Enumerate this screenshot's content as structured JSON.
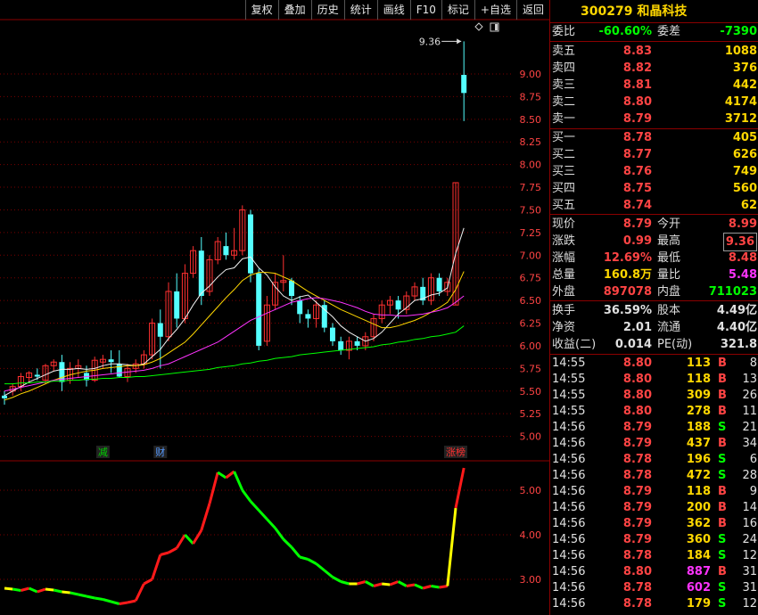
{
  "toolbar": {
    "buttons": [
      "复权",
      "叠加",
      "历史",
      "统计",
      "画线",
      "F10",
      "标记",
      "+自选",
      "返回"
    ]
  },
  "kline": {
    "price_labels": [
      "9.00",
      "8.75",
      "8.50",
      "8.25",
      "8.00",
      "7.75",
      "7.50",
      "7.25",
      "7.00",
      "6.75",
      "6.50",
      "6.25",
      "6.00",
      "5.75",
      "5.50",
      "5.25",
      "5.00"
    ],
    "high_marker": "9.36",
    "event_tags": [
      "减",
      "财",
      "涨榜"
    ]
  },
  "indicator": {
    "labels": [
      "5.00",
      "4.00",
      "3.00"
    ]
  },
  "chart_data": [
    {
      "type": "candlestick",
      "ylim": [
        4.75,
        9.6
      ],
      "candles": [
        [
          5.45,
          5.5,
          5.35,
          5.42
        ],
        [
          5.5,
          5.58,
          5.45,
          5.55
        ],
        [
          5.55,
          5.7,
          5.5,
          5.66
        ],
        [
          5.65,
          5.72,
          5.6,
          5.7
        ],
        [
          5.68,
          5.75,
          5.62,
          5.66
        ],
        [
          5.62,
          5.8,
          5.58,
          5.78
        ],
        [
          5.78,
          5.85,
          5.72,
          5.82
        ],
        [
          5.82,
          5.9,
          5.5,
          5.6
        ],
        [
          5.62,
          5.82,
          5.58,
          5.75
        ],
        [
          5.75,
          5.85,
          5.65,
          5.78
        ],
        [
          5.7,
          5.78,
          5.55,
          5.62
        ],
        [
          5.62,
          5.88,
          5.6,
          5.84
        ],
        [
          5.82,
          5.9,
          5.75,
          5.85
        ],
        [
          5.85,
          5.95,
          5.7,
          5.82
        ],
        [
          5.8,
          5.95,
          5.65,
          5.66
        ],
        [
          5.66,
          5.8,
          5.6,
          5.75
        ],
        [
          5.75,
          5.85,
          5.7,
          5.8
        ],
        [
          5.8,
          5.95,
          5.75,
          5.9
        ],
        [
          5.9,
          6.3,
          5.85,
          6.25
        ],
        [
          6.25,
          6.4,
          5.75,
          6.1
        ],
        [
          6.1,
          6.7,
          6.05,
          6.6
        ],
        [
          6.6,
          6.8,
          6.2,
          6.3
        ],
        [
          6.3,
          6.9,
          6.25,
          6.8
        ],
        [
          6.8,
          7.1,
          6.75,
          7.05
        ],
        [
          7.05,
          7.2,
          6.45,
          6.55
        ],
        [
          6.6,
          7.0,
          6.55,
          6.95
        ],
        [
          6.95,
          7.2,
          6.9,
          7.15
        ],
        [
          7.1,
          7.25,
          6.95,
          7.0
        ],
        [
          7.0,
          7.3,
          6.95,
          7.05
        ],
        [
          7.05,
          7.55,
          7.0,
          7.5
        ],
        [
          7.45,
          7.5,
          6.7,
          6.8
        ],
        [
          6.8,
          6.85,
          5.95,
          6.0
        ],
        [
          6.05,
          6.55,
          6.0,
          6.45
        ],
        [
          6.45,
          6.8,
          6.4,
          6.7
        ],
        [
          6.7,
          7.0,
          6.6,
          6.72
        ],
        [
          6.72,
          6.75,
          6.45,
          6.55
        ],
        [
          6.5,
          6.55,
          6.25,
          6.35
        ],
        [
          6.35,
          6.4,
          6.2,
          6.3
        ],
        [
          6.3,
          6.5,
          6.2,
          6.45
        ],
        [
          6.45,
          6.5,
          6.15,
          6.2
        ],
        [
          6.2,
          6.25,
          6.0,
          6.05
        ],
        [
          6.05,
          6.1,
          5.9,
          5.95
        ],
        [
          5.95,
          6.1,
          5.85,
          6.05
        ],
        [
          6.05,
          6.1,
          5.95,
          6.0
        ],
        [
          6.0,
          6.15,
          5.95,
          6.1
        ],
        [
          6.1,
          6.35,
          6.05,
          6.3
        ],
        [
          6.3,
          6.5,
          6.25,
          6.45
        ],
        [
          6.45,
          6.55,
          6.35,
          6.5
        ],
        [
          6.5,
          6.55,
          6.3,
          6.4
        ],
        [
          6.4,
          6.6,
          6.35,
          6.55
        ],
        [
          6.55,
          6.7,
          6.5,
          6.65
        ],
        [
          6.65,
          6.75,
          6.45,
          6.5
        ],
        [
          6.5,
          6.8,
          6.45,
          6.75
        ],
        [
          6.75,
          6.8,
          6.55,
          6.6
        ],
        [
          6.6,
          6.75,
          6.55,
          6.7
        ],
        [
          6.45,
          7.8,
          6.45,
          7.8
        ],
        [
          8.99,
          9.36,
          8.48,
          8.79
        ]
      ],
      "ma": {
        "ma5_white": [
          5.45,
          5.5,
          5.55,
          5.6,
          5.64,
          5.68,
          5.72,
          5.74,
          5.74,
          5.75,
          5.74,
          5.75,
          5.78,
          5.8,
          5.8,
          5.79,
          5.78,
          5.8,
          5.88,
          5.96,
          6.08,
          6.18,
          6.3,
          6.45,
          6.58,
          6.66,
          6.76,
          6.84,
          6.86,
          6.96,
          6.98,
          6.86,
          6.78,
          6.65,
          6.55,
          6.5,
          6.54,
          6.56,
          6.48,
          6.4,
          6.32,
          6.22,
          6.15,
          6.1,
          6.05,
          6.08,
          6.15,
          6.25,
          6.35,
          6.42,
          6.5,
          6.52,
          6.56,
          6.58,
          6.64,
          7.02,
          7.3
        ],
        "ma10_yellow": [
          5.4,
          5.43,
          5.47,
          5.5,
          5.54,
          5.58,
          5.62,
          5.65,
          5.68,
          5.7,
          5.72,
          5.73,
          5.75,
          5.76,
          5.77,
          5.78,
          5.78,
          5.79,
          5.82,
          5.86,
          5.92,
          5.98,
          6.04,
          6.13,
          6.23,
          6.33,
          6.43,
          6.53,
          6.62,
          6.72,
          6.78,
          6.81,
          6.81,
          6.8,
          6.76,
          6.72,
          6.66,
          6.6,
          6.55,
          6.5,
          6.45,
          6.4,
          6.36,
          6.32,
          6.28,
          6.24,
          6.2,
          6.2,
          6.22,
          6.25,
          6.28,
          6.32,
          6.37,
          6.42,
          6.48,
          6.62,
          6.82
        ],
        "ma20_magenta": [
          5.5,
          5.52,
          5.54,
          5.56,
          5.58,
          5.6,
          5.62,
          5.63,
          5.64,
          5.65,
          5.66,
          5.67,
          5.68,
          5.69,
          5.7,
          5.71,
          5.72,
          5.73,
          5.75,
          5.78,
          5.8,
          5.84,
          5.88,
          5.92,
          5.96,
          6.0,
          6.04,
          6.1,
          6.16,
          6.22,
          6.28,
          6.32,
          6.36,
          6.4,
          6.44,
          6.48,
          6.5,
          6.52,
          6.53,
          6.52,
          6.5,
          6.48,
          6.45,
          6.42,
          6.38,
          6.35,
          6.34,
          6.34,
          6.33,
          6.33,
          6.34,
          6.35,
          6.37,
          6.39,
          6.42,
          6.48,
          6.55
        ],
        "ma60_green": [
          5.58,
          5.58,
          5.59,
          5.59,
          5.6,
          5.6,
          5.61,
          5.61,
          5.62,
          5.62,
          5.63,
          5.63,
          5.64,
          5.64,
          5.65,
          5.65,
          5.66,
          5.66,
          5.67,
          5.68,
          5.69,
          5.7,
          5.71,
          5.72,
          5.73,
          5.74,
          5.76,
          5.77,
          5.78,
          5.8,
          5.81,
          5.83,
          5.84,
          5.86,
          5.87,
          5.88,
          5.9,
          5.91,
          5.92,
          5.93,
          5.94,
          5.95,
          5.96,
          5.97,
          5.98,
          5.99,
          6.01,
          6.02,
          6.04,
          6.05,
          6.07,
          6.08,
          6.1,
          6.11,
          6.13,
          6.15,
          6.22
        ]
      }
    },
    {
      "type": "line",
      "ylim": [
        2.2,
        5.6
      ],
      "values": [
        2.8,
        2.78,
        2.75,
        2.8,
        2.72,
        2.78,
        2.76,
        2.72,
        2.7,
        2.66,
        2.62,
        2.58,
        2.55,
        2.5,
        2.45,
        2.48,
        2.52,
        2.9,
        3.0,
        3.55,
        3.6,
        3.7,
        4.0,
        3.8,
        4.1,
        4.7,
        5.4,
        5.28,
        5.42,
        5.0,
        4.75,
        4.55,
        4.35,
        4.15,
        3.9,
        3.72,
        3.5,
        3.45,
        3.35,
        3.2,
        3.05,
        2.95,
        2.9,
        2.9,
        2.95,
        2.85,
        2.9,
        2.88,
        2.95,
        2.85,
        2.88,
        2.8,
        2.85,
        2.82,
        2.85,
        4.6,
        5.5
      ]
    }
  ],
  "quote": {
    "title": "300279 和晶科技",
    "weibi_label": "委比",
    "weibi": "-60.60%",
    "weicha_label": "委差",
    "weicha": "-7390",
    "asks": [
      {
        "label": "卖五",
        "price": "8.83",
        "vol": "1088"
      },
      {
        "label": "卖四",
        "price": "8.82",
        "vol": "376"
      },
      {
        "label": "卖三",
        "price": "8.81",
        "vol": "442"
      },
      {
        "label": "卖二",
        "price": "8.80",
        "vol": "4174"
      },
      {
        "label": "卖一",
        "price": "8.79",
        "vol": "3712"
      }
    ],
    "bids": [
      {
        "label": "买一",
        "price": "8.78",
        "vol": "405"
      },
      {
        "label": "买二",
        "price": "8.77",
        "vol": "626"
      },
      {
        "label": "买三",
        "price": "8.76",
        "vol": "749"
      },
      {
        "label": "买四",
        "price": "8.75",
        "vol": "560"
      },
      {
        "label": "买五",
        "price": "8.74",
        "vol": "62"
      }
    ],
    "stats": [
      {
        "l1": "现价",
        "v1": "8.79",
        "l2": "今开",
        "v2": "8.99"
      },
      {
        "l1": "涨跌",
        "v1": "0.99",
        "l2": "最高",
        "v2": "9.36"
      },
      {
        "l1": "涨幅",
        "v1": "12.69%",
        "l2": "最低",
        "v2": "8.48"
      },
      {
        "l1": "总量",
        "v1": "160.8万",
        "l2": "量比",
        "v2": "5.48"
      },
      {
        "l1": "外盘",
        "v1": "897078",
        "l2": "内盘",
        "v2": "711023"
      }
    ],
    "stats2": [
      {
        "l1": "换手",
        "v1": "36.59%",
        "l2": "股本",
        "v2": "4.49亿"
      },
      {
        "l1": "净资",
        "v1": "2.01",
        "l2": "流通",
        "v2": "4.40亿"
      },
      {
        "l1": "收益(二)",
        "v1": "0.014",
        "l2": "PE(动)",
        "v2": "321.8"
      }
    ],
    "colors": {
      "up": "#ff4444",
      "down": "#00ff00",
      "neutral": "#e0e0e0",
      "accent": "#ffd700",
      "highlight": "#ff33ff"
    }
  },
  "ticks": [
    {
      "time": "14:55",
      "price": "8.80",
      "vol": "113",
      "bs": "B",
      "n": "8"
    },
    {
      "time": "14:55",
      "price": "8.80",
      "vol": "118",
      "bs": "B",
      "n": "13"
    },
    {
      "time": "14:55",
      "price": "8.80",
      "vol": "309",
      "bs": "B",
      "n": "26"
    },
    {
      "time": "14:55",
      "price": "8.80",
      "vol": "278",
      "bs": "B",
      "n": "11"
    },
    {
      "time": "14:56",
      "price": "8.79",
      "vol": "188",
      "bs": "S",
      "n": "21"
    },
    {
      "time": "14:56",
      "price": "8.79",
      "vol": "437",
      "bs": "B",
      "n": "34"
    },
    {
      "time": "14:56",
      "price": "8.78",
      "vol": "196",
      "bs": "S",
      "n": "6"
    },
    {
      "time": "14:56",
      "price": "8.78",
      "vol": "472",
      "bs": "S",
      "n": "28"
    },
    {
      "time": "14:56",
      "price": "8.79",
      "vol": "118",
      "bs": "B",
      "n": "9"
    },
    {
      "time": "14:56",
      "price": "8.79",
      "vol": "200",
      "bs": "B",
      "n": "14"
    },
    {
      "time": "14:56",
      "price": "8.79",
      "vol": "362",
      "bs": "B",
      "n": "16"
    },
    {
      "time": "14:56",
      "price": "8.79",
      "vol": "360",
      "bs": "S",
      "n": "24"
    },
    {
      "time": "14:56",
      "price": "8.78",
      "vol": "184",
      "bs": "S",
      "n": "12"
    },
    {
      "time": "14:56",
      "price": "8.80",
      "vol": "887",
      "bs": "B",
      "n": "31"
    },
    {
      "time": "14:56",
      "price": "8.78",
      "vol": "602",
      "bs": "S",
      "n": "31"
    },
    {
      "time": "14:56",
      "price": "8.78",
      "vol": "179",
      "bs": "S",
      "n": "12"
    }
  ]
}
